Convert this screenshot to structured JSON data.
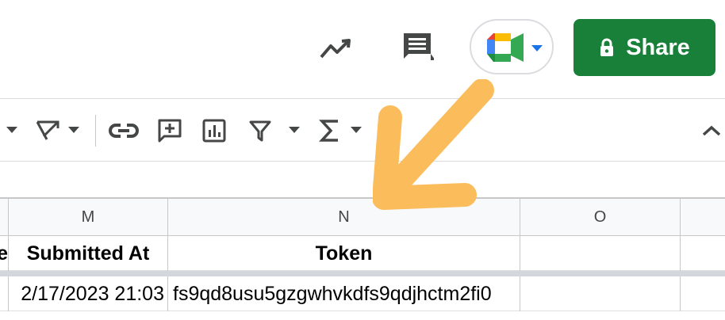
{
  "header": {
    "share_label": "Share"
  },
  "grid": {
    "columns": [
      "M",
      "N",
      "O"
    ],
    "header_row": {
      "col_left_partial": "e",
      "M": "Submitted At",
      "N": "Token",
      "O": ""
    },
    "data_rows": [
      {
        "M": "2/17/2023 21:03",
        "N": "fs9qd8usu5gzgwhvkdfs9qdjhctm2fi0",
        "O": ""
      }
    ]
  },
  "colors": {
    "share_green": "#188038",
    "arrow_orange": "#fbbc5b"
  },
  "icons": [
    "explore-trend-icon",
    "comments-icon",
    "google-meet-icon",
    "dropdown-arrow-icon",
    "lock-icon",
    "text-rotation-icon",
    "link-icon",
    "insert-comment-icon",
    "insert-chart-icon",
    "filter-icon",
    "functions-icon",
    "collapse-toolbar-icon",
    "annotation-arrow-icon"
  ]
}
